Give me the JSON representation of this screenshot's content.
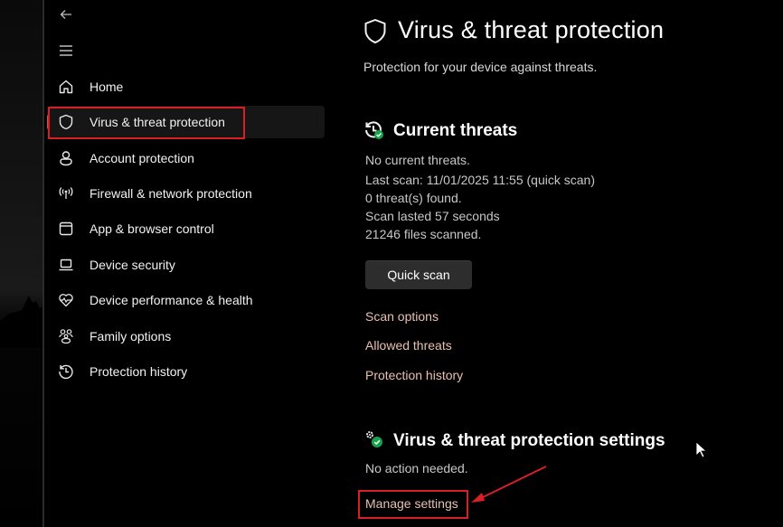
{
  "nav": {
    "back_icon": "arrow-left-icon",
    "menu_icon": "hamburger-icon",
    "items": [
      {
        "label": "Home",
        "icon": "home-icon"
      },
      {
        "label": "Virus & threat protection",
        "icon": "shield-icon",
        "selected": true
      },
      {
        "label": "Account protection",
        "icon": "person-icon"
      },
      {
        "label": "Firewall & network protection",
        "icon": "wireless-antenna-icon"
      },
      {
        "label": "App & browser control",
        "icon": "app-window-icon"
      },
      {
        "label": "Device security",
        "icon": "laptop-icon"
      },
      {
        "label": "Device performance & health",
        "icon": "heart-pulse-icon"
      },
      {
        "label": "Family options",
        "icon": "family-icon"
      },
      {
        "label": "Protection history",
        "icon": "history-clock-icon"
      }
    ]
  },
  "page": {
    "title": "Virus & threat protection",
    "subtitle": "Protection for your device against threats."
  },
  "current_threats": {
    "heading": "Current threats",
    "status": "No current threats.",
    "last_scan": "Last scan: 11/01/2025 11:55 (quick scan)",
    "threats_found": "0 threat(s) found.",
    "scan_duration": "Scan lasted 57 seconds",
    "files_scanned": "21246 files scanned.",
    "quick_scan_label": "Quick scan",
    "links": [
      "Scan options",
      "Allowed threats",
      "Protection history"
    ]
  },
  "settings": {
    "heading": "Virus & threat protection settings",
    "status": "No action needed.",
    "manage_label": "Manage settings"
  },
  "colors": {
    "accent_link": "#e8c1b0",
    "annotation_red": "#d81f26",
    "status_green": "#16a34a"
  }
}
